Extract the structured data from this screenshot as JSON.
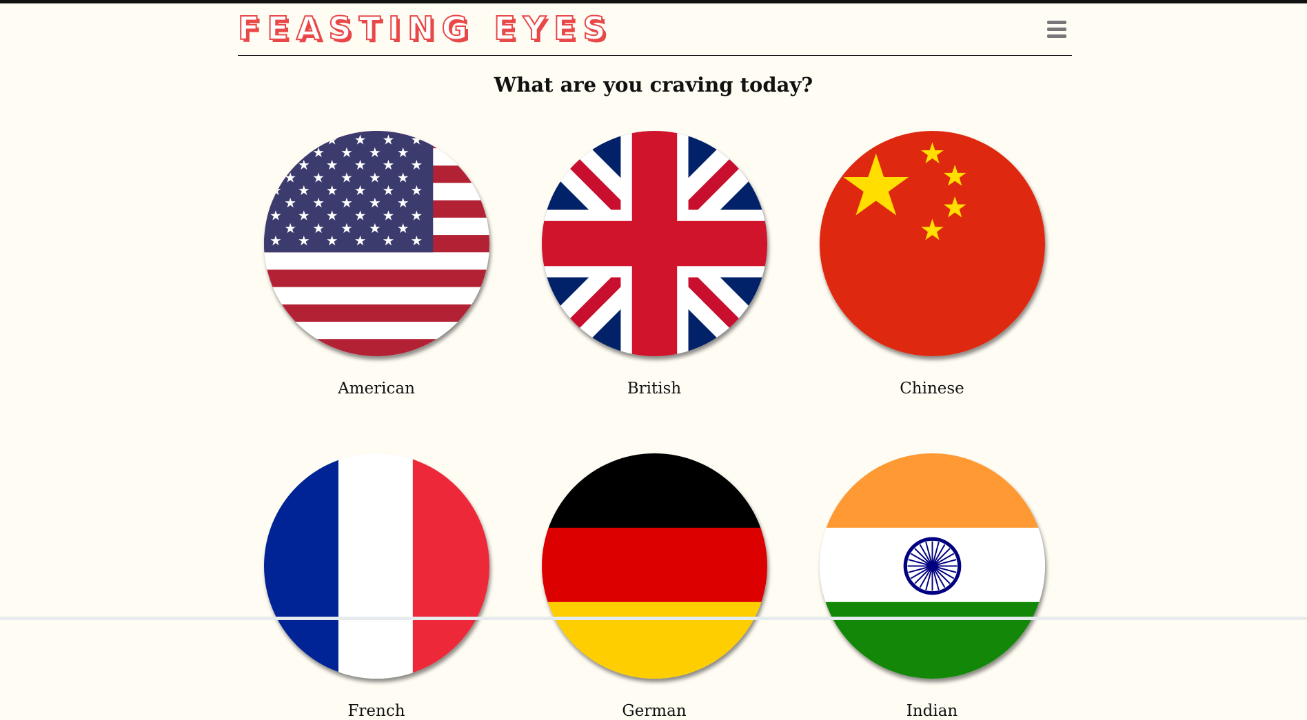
{
  "header": {
    "logo": "FEASTING EYES",
    "menu_icon": "hamburger-icon"
  },
  "main": {
    "heading": "What are you craving today?",
    "cuisines": [
      {
        "label": "American",
        "flag": "us-flag-icon"
      },
      {
        "label": "British",
        "flag": "uk-flag-icon"
      },
      {
        "label": "Chinese",
        "flag": "china-flag-icon"
      },
      {
        "label": "French",
        "flag": "france-flag-icon"
      },
      {
        "label": "German",
        "flag": "germany-flag-icon"
      },
      {
        "label": "Indian",
        "flag": "india-flag-icon"
      }
    ]
  },
  "colors": {
    "background": "#fffcf3",
    "logo": "#e84848"
  }
}
